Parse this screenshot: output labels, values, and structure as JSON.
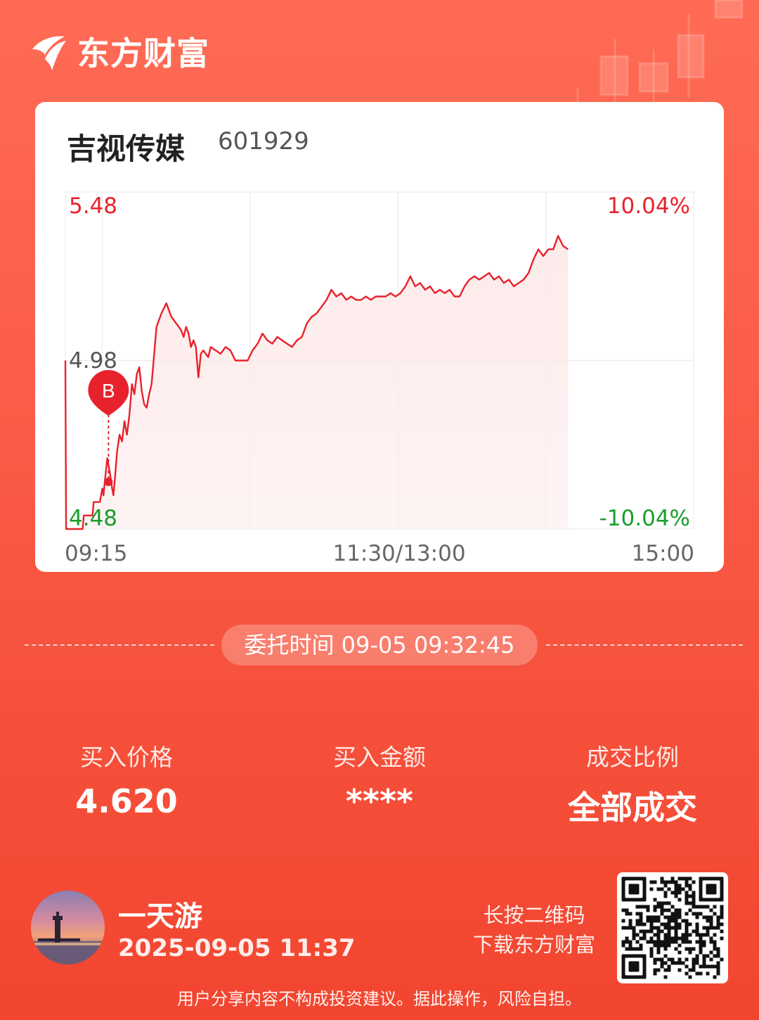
{
  "brand": {
    "name": "东方财富",
    "logo_icon": "eastmoney-logo-icon"
  },
  "stock": {
    "name": "吉视传媒",
    "code": "601929"
  },
  "chart_data": {
    "type": "line",
    "title": "",
    "y_price_labels": {
      "top": "5.48",
      "middle": "4.98",
      "bottom": "4.48"
    },
    "y_pct_labels": {
      "top": "10.04%",
      "bottom": "-10.04%"
    },
    "x_labels": {
      "start": "09:15",
      "middle": "11:30/13:00",
      "end": "15:00"
    },
    "ylim": [
      4.48,
      5.48
    ],
    "prev_close": 4.98,
    "trade_marker": {
      "label": "B",
      "time_min": 17.5,
      "price": 4.62
    },
    "series": [
      {
        "color": "#e8222c",
        "points": [
          [
            0,
            4.98
          ],
          [
            0.3,
            4.48
          ],
          [
            1,
            4.48
          ],
          [
            7,
            4.48
          ],
          [
            7.5,
            4.52
          ],
          [
            11,
            4.52
          ],
          [
            11.5,
            4.56
          ],
          [
            14,
            4.56
          ],
          [
            15,
            4.6
          ],
          [
            15.5,
            4.58
          ],
          [
            16,
            4.62
          ],
          [
            17,
            4.69
          ],
          [
            18,
            4.65
          ],
          [
            19,
            4.6
          ],
          [
            19.5,
            4.58
          ],
          [
            20,
            4.62
          ],
          [
            21,
            4.71
          ],
          [
            22,
            4.76
          ],
          [
            23,
            4.74
          ],
          [
            24,
            4.8
          ],
          [
            25,
            4.76
          ],
          [
            26,
            4.82
          ],
          [
            27,
            4.91
          ],
          [
            28,
            4.88
          ],
          [
            29,
            4.94
          ],
          [
            30,
            4.96
          ],
          [
            31,
            4.89
          ],
          [
            32,
            4.85
          ],
          [
            33,
            4.84
          ],
          [
            34,
            4.88
          ],
          [
            35,
            4.91
          ],
          [
            37,
            5.08
          ],
          [
            39,
            5.12
          ],
          [
            41,
            5.15
          ],
          [
            43,
            5.11
          ],
          [
            45,
            5.09
          ],
          [
            47,
            5.07
          ],
          [
            48,
            5.05
          ],
          [
            49,
            5.08
          ],
          [
            50,
            5.06
          ],
          [
            51,
            5.02
          ],
          [
            52,
            5.04
          ],
          [
            53,
            5.02
          ],
          [
            54,
            4.93
          ],
          [
            55,
            5.0
          ],
          [
            56,
            5.01
          ],
          [
            58,
            4.99
          ],
          [
            59,
            5.02
          ],
          [
            61,
            5.01
          ],
          [
            63,
            5.0
          ],
          [
            65,
            5.02
          ],
          [
            67,
            5.01
          ],
          [
            69,
            4.98
          ],
          [
            71,
            4.98
          ],
          [
            74,
            4.98
          ],
          [
            76,
            5.01
          ],
          [
            78,
            5.03
          ],
          [
            80,
            5.06
          ],
          [
            82,
            5.04
          ],
          [
            84,
            5.03
          ],
          [
            86,
            5.05
          ],
          [
            88,
            5.04
          ],
          [
            90,
            5.03
          ],
          [
            92,
            5.02
          ],
          [
            94,
            5.04
          ],
          [
            96,
            5.05
          ],
          [
            98,
            5.09
          ],
          [
            100,
            5.11
          ],
          [
            102,
            5.12
          ],
          [
            104,
            5.14
          ],
          [
            106,
            5.16
          ],
          [
            108,
            5.19
          ],
          [
            110,
            5.17
          ],
          [
            112,
            5.18
          ],
          [
            114,
            5.16
          ],
          [
            116,
            5.17
          ],
          [
            118,
            5.16
          ],
          [
            120,
            5.16
          ],
          [
            122,
            5.17
          ],
          [
            124,
            5.16
          ],
          [
            126,
            5.17
          ],
          [
            128,
            5.17
          ],
          [
            130,
            5.17
          ],
          [
            132,
            5.18
          ],
          [
            134,
            5.17
          ],
          [
            136,
            5.18
          ],
          [
            138,
            5.2
          ],
          [
            140,
            5.23
          ],
          [
            142,
            5.2
          ],
          [
            144,
            5.21
          ],
          [
            146,
            5.19
          ],
          [
            148,
            5.2
          ],
          [
            150,
            5.18
          ],
          [
            152,
            5.19
          ],
          [
            154,
            5.18
          ],
          [
            156,
            5.19
          ],
          [
            158,
            5.17
          ],
          [
            160,
            5.17
          ],
          [
            162,
            5.2
          ],
          [
            164,
            5.22
          ],
          [
            166,
            5.23
          ],
          [
            168,
            5.22
          ],
          [
            170,
            5.23
          ],
          [
            172,
            5.24
          ],
          [
            174,
            5.22
          ],
          [
            176,
            5.23
          ],
          [
            178,
            5.21
          ],
          [
            180,
            5.22
          ],
          [
            182,
            5.2
          ],
          [
            184,
            5.21
          ],
          [
            186,
            5.22
          ],
          [
            188,
            5.24
          ],
          [
            190,
            5.28
          ],
          [
            192,
            5.31
          ],
          [
            194,
            5.29
          ],
          [
            196,
            5.31
          ],
          [
            198,
            5.31
          ],
          [
            200,
            5.35
          ],
          [
            202,
            5.32
          ],
          [
            204,
            5.31
          ]
        ]
      }
    ]
  },
  "order": {
    "time_label": "委托时间",
    "time_value": "09-05 09:32:45"
  },
  "stats": [
    {
      "label": "买入价格",
      "value": "4.620"
    },
    {
      "label": "买入金额",
      "value": "****"
    },
    {
      "label": "成交比例",
      "value": "全部成交"
    }
  ],
  "user": {
    "name": "一天游",
    "time": "2025-09-05 11:37",
    "avatar_icon": "avatar-lighthouse-photo"
  },
  "qr": {
    "line1": "长按二维码",
    "line2": "下载东方财富",
    "icon": "qr-code-icon"
  },
  "disclaimer": "用户分享内容不构成投资建议。据此操作，风险自担。"
}
